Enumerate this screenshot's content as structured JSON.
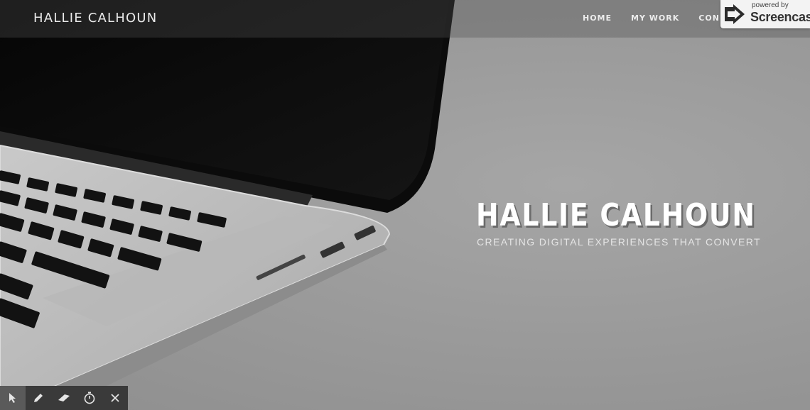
{
  "nav": {
    "brand": "HALLIE CALHOUN",
    "links": [
      {
        "label": "HOME"
      },
      {
        "label": "MY WORK"
      },
      {
        "label": "CON"
      }
    ]
  },
  "hero": {
    "title": "HALLIE CALHOUN",
    "subtitle": "CREATING DIGITAL EXPERIENCES THAT CONVERT"
  },
  "watermark": {
    "small": "powered by",
    "big": "Screencas"
  },
  "toolbar": {
    "tools": [
      {
        "icon": "cursor-icon"
      },
      {
        "icon": "pencil-icon"
      },
      {
        "icon": "eraser-icon"
      },
      {
        "icon": "timer-icon"
      },
      {
        "icon": "close-icon"
      }
    ]
  }
}
